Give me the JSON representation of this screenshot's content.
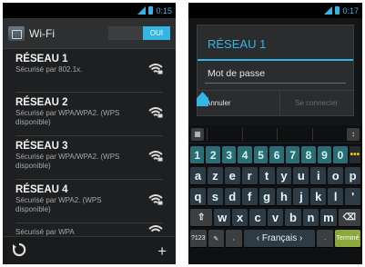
{
  "left": {
    "status": {
      "time": "0:15"
    },
    "header": {
      "title": "Wi-Fi",
      "toggle_label": "OUI"
    },
    "networks": [
      {
        "name": "RÉSEAU 1",
        "security": "Sécurisé par 802.1x."
      },
      {
        "name": "RÉSEAU 2",
        "security": "Sécurisé par WPA/WPA2. (WPS disponible)"
      },
      {
        "name": "RÉSEAU 3",
        "security": "Sécurisé par WPA/WPA2. (WPS disponible)"
      },
      {
        "name": "RÉSEAU 4",
        "security": "Sécurisé par WPA2. (WPS disponible)"
      },
      {
        "name": "",
        "security": "Sécurisé par WPA"
      }
    ],
    "bottom": {
      "add_label": "+"
    }
  },
  "right": {
    "status": {
      "time": "0:17"
    },
    "dialog": {
      "title": "RÉSEAU 1",
      "password_label": "Mot de passe",
      "cancel_label": "Annuler",
      "connect_label": "Se connecter"
    },
    "keyboard": {
      "numbers": [
        "1",
        "2",
        "3",
        "4",
        "5",
        "6",
        "7",
        "8",
        "9",
        "0"
      ],
      "more_label": "•••",
      "row1": [
        "a",
        "z",
        "e",
        "r",
        "t",
        "y",
        "u",
        "i",
        "o",
        "p"
      ],
      "row2": [
        "q",
        "s",
        "d",
        "f",
        "g",
        "h",
        "j",
        "k",
        "l",
        "'"
      ],
      "row3": [
        "w",
        "x",
        "c",
        "v",
        "b",
        "n",
        "m"
      ],
      "sym_label": "?123",
      "space_label": "‹ Français ›",
      "done_label": "Terminé"
    }
  },
  "colors": {
    "accent": "#33b5e5",
    "number_key": "#2a6d75",
    "done_key": "#8ba83a"
  }
}
